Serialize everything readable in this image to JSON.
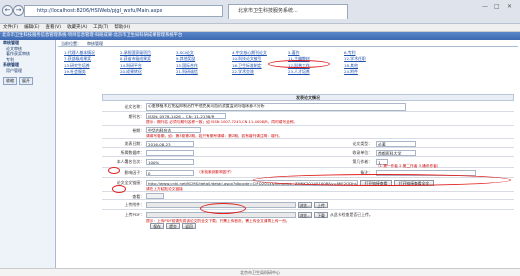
{
  "browser": {
    "url": "http://localhost:8206/HSIWeb/pjgl_wxfu/Main.aspx",
    "tab_title": "北京市卫生科技服务系统...",
    "back_icon": "back-arrow-icon",
    "forward_icon": "forward-arrow-icon"
  },
  "menubar": [
    "文件(F)",
    "编辑(E)",
    "查看(V)",
    "收藏夹(A)",
    "工具(T)",
    "帮助(H)"
  ],
  "banner": "北京市卫生科技服务信息管理系统·项目信息管理·科研成果·北京市卫生局科研成果管理系统平台",
  "sidebar": {
    "items": [
      {
        "label": "审核管理",
        "kind": "grp"
      },
      {
        "label": "论文审核",
        "kind": "sub"
      },
      {
        "label": "著作获奖审核",
        "kind": "sub"
      },
      {
        "label": "专利",
        "kind": "sub"
      },
      {
        "label": "系统管理",
        "kind": "grp"
      },
      {
        "label": "用户管理",
        "kind": "sub"
      }
    ],
    "buttons": [
      "收缩",
      "展开"
    ]
  },
  "main": {
    "tabs": [
      "当前位置：",
      "审核管理"
    ],
    "links": [
      [
        "1.代理人基本情况",
        "2.承担国家级项目",
        "3.SCI论文",
        "4.中文核心期刊论文",
        "5.著作",
        "6.专利"
      ],
      [
        "7.获部级成果奖",
        "8.获省市级成果奖",
        "9.其他奖励",
        "10.科技论文被引",
        "11.主编教材",
        "12.学术任职"
      ],
      [
        "13.研究生培养",
        "14.科研平台",
        "15.国际合作",
        "16.卫生标准制定",
        "17.科普工作",
        "18.其他"
      ],
      [
        "19.社会服务",
        "20.成果转化",
        "21.科研诚信",
        "22.学术交流",
        "23.人才培养",
        "24.附件"
      ]
    ],
    "section_title": "发表论文情况",
    "fields": {
      "title_label": "论文名称：",
      "title_value": "心脏移植术后免疫抑制治疗中他克莫司血药浓度监测与临床意义分析",
      "journal_label": "期刊名：",
      "journal_value": "ISSN: 0578-1426 ，CN: 11-2138/R",
      "journal_note": "提示：期刊名 必须与期刊名称一致；如 ISSN 1007-7243,CN 11-4008/R，同时填写全称。",
      "issue_label": "卷期：",
      "issue_value": "中华内科杂志",
      "issue_note": "请填写卷期，如：第3卷第2期，若只有期号请填：第2期，若有增刊请注明：增刊。",
      "date_label": "发表日期：",
      "date_value": "2016-08-23",
      "type_label": "论文类型：",
      "type_value": "论著",
      "index_label": "所属数据库：",
      "index_value": "",
      "unit_label": "收录单位：",
      "unit_value": "首都医科大学",
      "author_label": "本人署名位次：",
      "author_value": "100%",
      "rank_label": "第几作者：",
      "rank_value": "1",
      "rank_note": "（1.第一作者 2.第二作者 3.通讯作者）",
      "impact_label": "影响因子：",
      "impact_value": "0",
      "impact_note": "（未检索到影响因子）",
      "remark_label": "备注：",
      "remark_value": "",
      "link_label": "论文全文链接：",
      "link_value": "http://www.cnki.net/KCMS/detail/detail.aspx?dbcode=CJFD2014&filename=ZHNK201401008&v=MjE2ODhUclBuR2JyRzRIOVhNcm85",
      "open_link_btn": "打开链接查看",
      "open_full_btn": "打开链接查看全文",
      "link_note": "请在上方粘贴论文链接",
      "view_label": "查看：",
      "upload_label": "上传附件：",
      "browse_btn": "浏览...",
      "upload_btn": "上传",
      "upload_file_label": "上传PDF：",
      "download_btn": "下载",
      "upload_hint": "从此卡检查是否已上传。",
      "upload_note": "提示：上传PDF前请先将该论文的全文下载；只需上传首页，需上传全文请再上传一份。"
    },
    "buttons": [
      "保存",
      "提交",
      "返回"
    ]
  },
  "status": "北京市卫生局科研中心"
}
